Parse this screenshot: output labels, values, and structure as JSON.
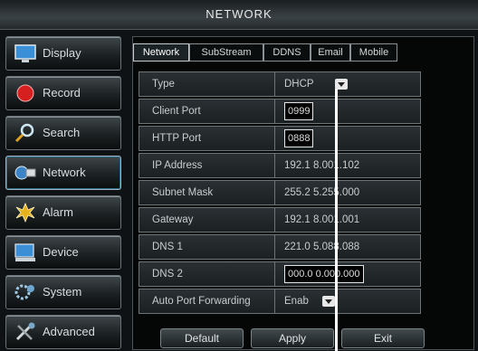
{
  "window": {
    "title": "NETWORK"
  },
  "sidebar": {
    "items": [
      {
        "label": "Display",
        "icon": "display-icon"
      },
      {
        "label": "Record",
        "icon": "record-icon"
      },
      {
        "label": "Search",
        "icon": "search-icon"
      },
      {
        "label": "Network",
        "icon": "network-icon",
        "active": true
      },
      {
        "label": "Alarm",
        "icon": "alarm-icon"
      },
      {
        "label": "Device",
        "icon": "device-icon"
      },
      {
        "label": "System",
        "icon": "system-icon"
      },
      {
        "label": "Advanced",
        "icon": "advanced-icon"
      }
    ]
  },
  "tabs": [
    {
      "label": "Network",
      "active": true
    },
    {
      "label": "SubStream"
    },
    {
      "label": "DDNS"
    },
    {
      "label": "Email"
    },
    {
      "label": "Mobile"
    }
  ],
  "settings": {
    "type": {
      "label": "Type",
      "value": "DHCP"
    },
    "client_port": {
      "label": "Client Port",
      "value": "0999"
    },
    "http_port": {
      "label": "HTTP Port",
      "value": "0888"
    },
    "ip_address": {
      "label": "IP Address",
      "value": "192.1  8.001.102"
    },
    "subnet_mask": {
      "label": "Subnet Mask",
      "value": "255.2  5.255.000"
    },
    "gateway": {
      "label": "Gateway",
      "value": "192.1  8.001.001"
    },
    "dns1": {
      "label": "DNS 1",
      "value": "221.0  5.088.088"
    },
    "dns2": {
      "label": "DNS 2",
      "value": "000.0  0.000.000"
    },
    "auto_port_forwarding": {
      "label": "Auto Port Forwarding",
      "value": "Enab"
    }
  },
  "buttons": {
    "default": "Default",
    "apply": "Apply",
    "exit": "Exit"
  },
  "colors": {
    "accent": "#2d6d88",
    "panel_bg": "#050707",
    "row_border": "#6c7478"
  }
}
